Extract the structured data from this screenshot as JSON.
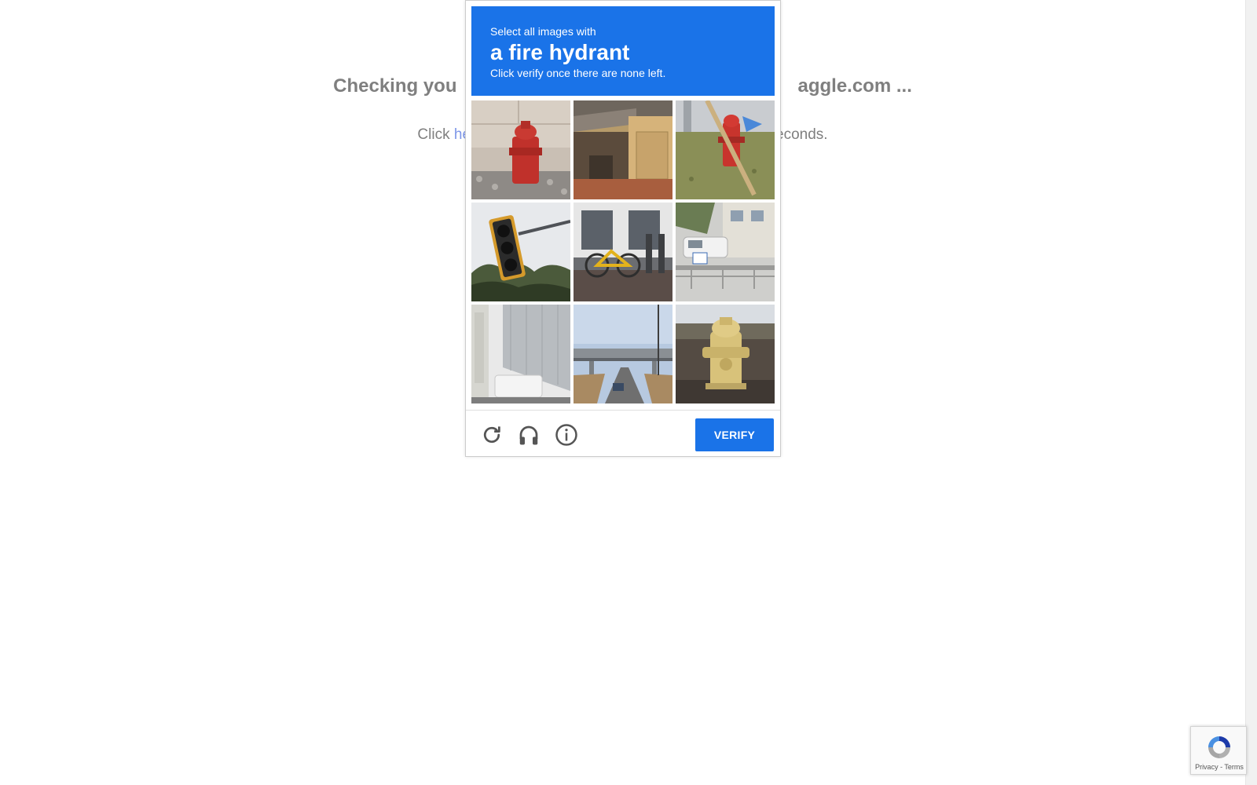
{
  "background": {
    "heading_left": "Checking you",
    "heading_right": "aggle.com ...",
    "sub_prefix": "Click ",
    "sub_link": "he",
    "sub_suffix": "econds."
  },
  "captcha": {
    "header": {
      "line1": "Select all images with",
      "target": "a fire hydrant",
      "line3": "Click verify once there are none left."
    },
    "tiles": [
      {
        "content": "red fire hydrant on cobblestone"
      },
      {
        "content": "garage with carport"
      },
      {
        "content": "red fire hydrant on grass with pole"
      },
      {
        "content": "traffic light"
      },
      {
        "content": "yellow bicycle by building"
      },
      {
        "content": "van parked by building with fence"
      },
      {
        "content": "building wall with japanese text"
      },
      {
        "content": "overpass bridge over road"
      },
      {
        "content": "yellow fire hydrant"
      }
    ],
    "footer": {
      "reload_icon": "reload-icon",
      "audio_icon": "headphones-icon",
      "info_icon": "info-icon",
      "verify_label": "VERIFY"
    }
  },
  "badge": {
    "privacy": "Privacy",
    "separator": " - ",
    "terms": "Terms"
  },
  "colors": {
    "accent": "#1a73e8",
    "background_text": "#7f7f7f",
    "link": "#7d96e8"
  }
}
